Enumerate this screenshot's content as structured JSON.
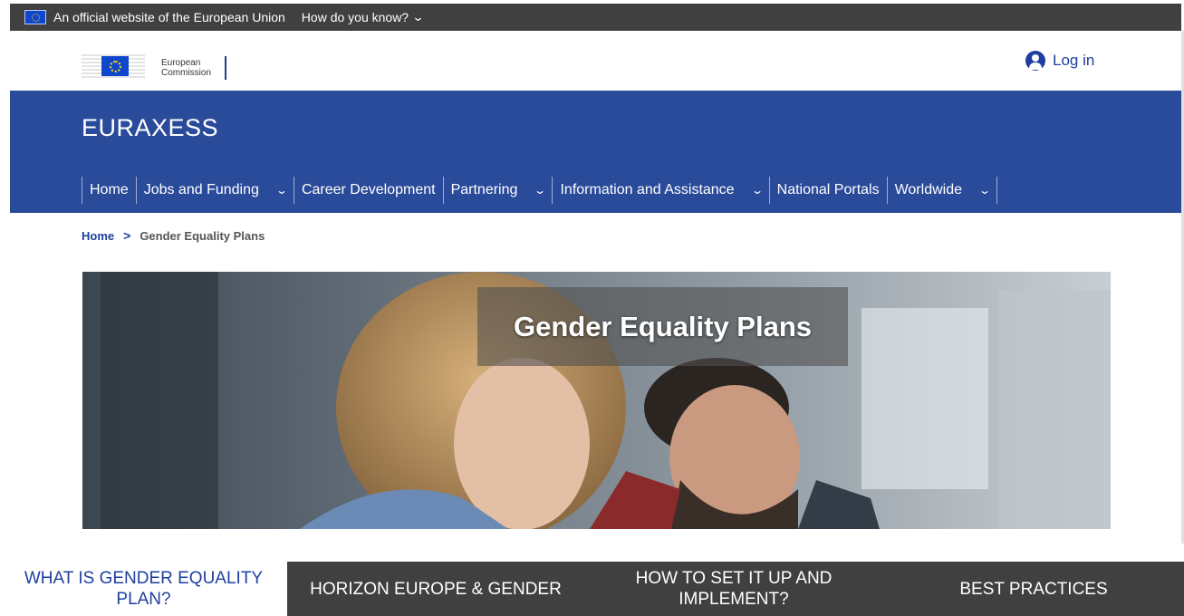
{
  "topbar": {
    "official_text": "An official website of the European Union",
    "how_know_label": "How do you know?",
    "chevron_icon": "chevron-down-icon"
  },
  "header": {
    "logo_line1": "European",
    "logo_line2": "Commission",
    "login_label": "Log in",
    "login_icon": "user-icon"
  },
  "site": {
    "title": "EURAXESS"
  },
  "nav": {
    "items": [
      {
        "label": "Home",
        "has_dropdown": false
      },
      {
        "label": "Jobs and Funding",
        "has_dropdown": true
      },
      {
        "label": "Career Development",
        "has_dropdown": false
      },
      {
        "label": "Partnering",
        "has_dropdown": true
      },
      {
        "label": "Information and Assistance",
        "has_dropdown": true
      },
      {
        "label": "National Portals",
        "has_dropdown": false
      },
      {
        "label": "Worldwide",
        "has_dropdown": true
      }
    ]
  },
  "breadcrumb": {
    "home": "Home",
    "current": "Gender Equality Plans"
  },
  "hero": {
    "title": "Gender Equality Plans"
  },
  "tabs": [
    {
      "label": "WHAT IS GENDER EQUALITY PLAN?",
      "active": true
    },
    {
      "label": "HORIZON EUROPE & GENDER",
      "active": false
    },
    {
      "label": "HOW TO SET IT UP AND IMPLEMENT?",
      "active": false
    },
    {
      "label": "BEST PRACTICES",
      "active": false
    }
  ],
  "colors": {
    "topbar_bg": "#404040",
    "brand_blue": "#2a4a9a",
    "link_blue": "#1e3f9f",
    "tab_bar_bg": "#404040"
  }
}
